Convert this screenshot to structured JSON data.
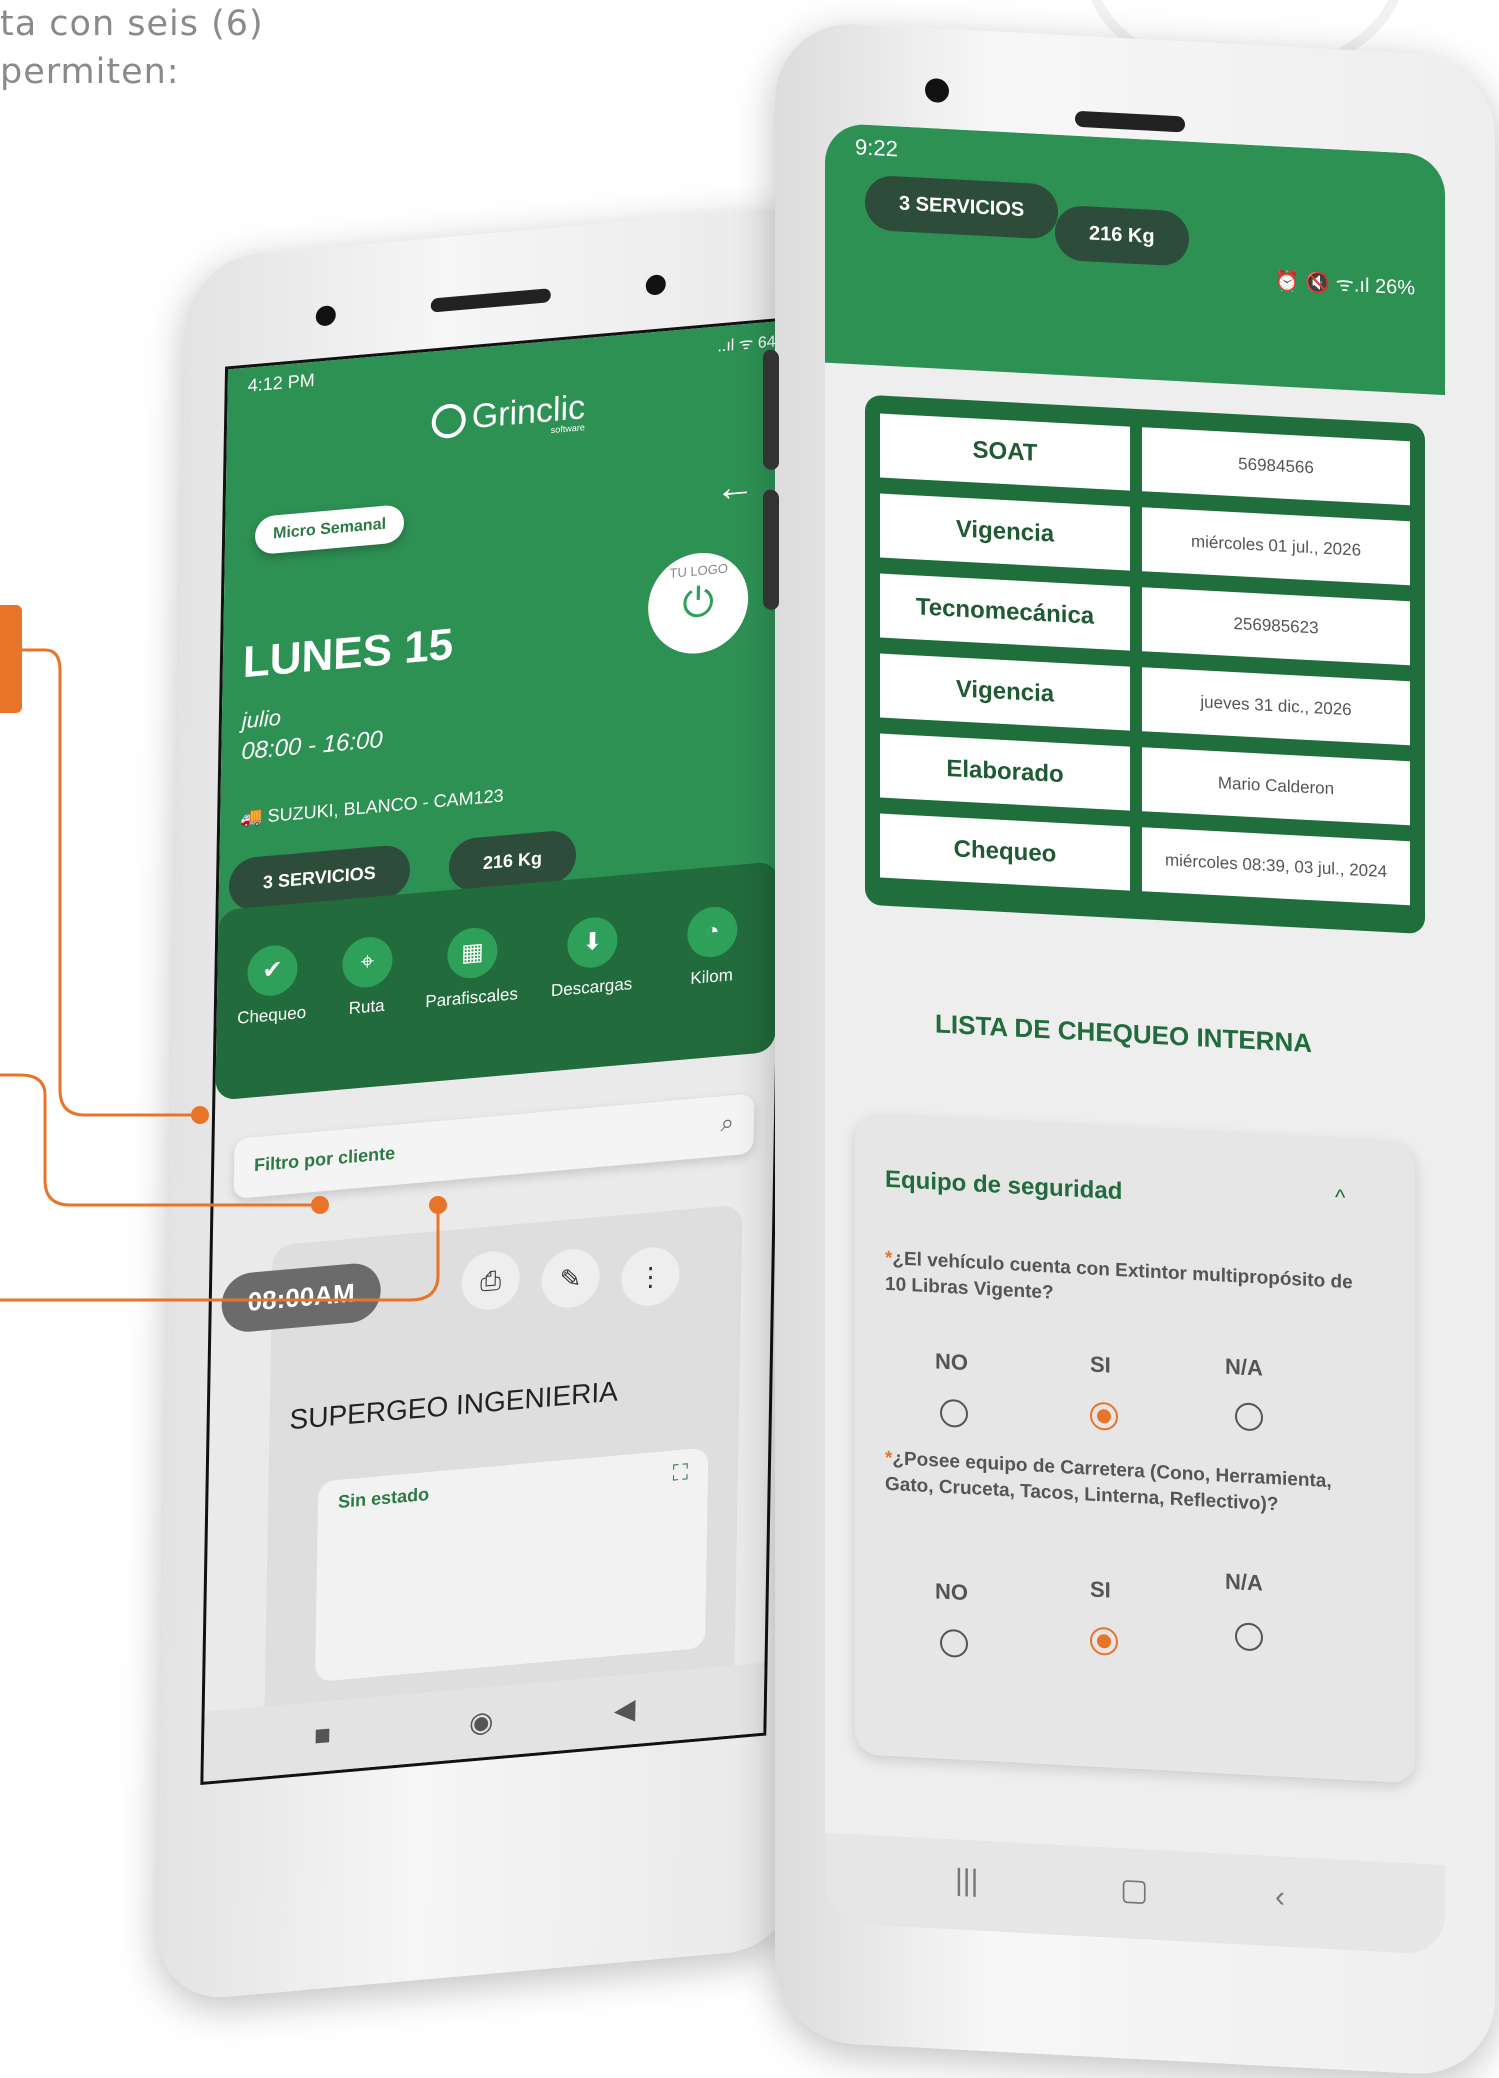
{
  "intro": {
    "line1": "ta con seis (6)",
    "line2": "permiten:"
  },
  "phone_left": {
    "status_time": "4:12 PM",
    "status_icons": "..ıl ᯤ 64",
    "logo_text": "Grinclic",
    "logo_sub": "software",
    "plan_pill": "Micro Semanal",
    "back_arrow": "←",
    "logo_placeholder": "TU LOGO",
    "day_title": "LUNES 15",
    "month": "julio",
    "hours": "08:00 - 16:00",
    "vehicle": "SUZUKI, BLANCO - CAM123",
    "services": "3 SERVICIOS",
    "weight": "216 Kg",
    "menu": [
      {
        "label": "Chequeo",
        "icon": "check-circle-icon",
        "glyph": "✔"
      },
      {
        "label": "Ruta",
        "icon": "map-pin-icon",
        "glyph": "⌖"
      },
      {
        "label": "Parafiscales",
        "icon": "grid-icon",
        "glyph": "▦"
      },
      {
        "label": "Descargas",
        "icon": "download-icon",
        "glyph": "⬇"
      },
      {
        "label": "Kilom",
        "icon": "gauge-icon",
        "glyph": "◔"
      }
    ],
    "filter_label": "Filtro por cliente",
    "search_glyph": "⌕",
    "time_pill": "08:00AM",
    "company": "SUPERGEO INGENIERIA",
    "status_partial": "Sin estado",
    "card_icon_glyph": "⛶",
    "pdf_glyph": "⎙",
    "edit_glyph": "✎",
    "more_glyph": "⋮",
    "nav": {
      "square": "■",
      "home": "◉",
      "back": "◀"
    }
  },
  "phone_right": {
    "status_time": "9:22",
    "status_icons": "⏰ 🔇 ᯤ.ıl 26%",
    "services": "3 SERVICIOS",
    "weight": "216 Kg",
    "table": [
      {
        "key": "SOAT",
        "value": "56984566"
      },
      {
        "key": "Vigencia",
        "value": "miércoles 01 jul., 2026"
      },
      {
        "key": "Tecnomecánica",
        "value": "256985623"
      },
      {
        "key": "Vigencia",
        "value": "jueves 31 dic., 2026"
      },
      {
        "key": "Elaborado",
        "value": "Mario Calderon"
      },
      {
        "key": "Chequeo",
        "value": "miércoles 08:39, 03 jul., 2024"
      }
    ],
    "list_title": "LISTA DE CHEQUEO INTERNA",
    "section_title": "Equipo de seguridad",
    "chevron": "^",
    "questions": [
      {
        "star": "*",
        "text": "¿El vehículo cuenta con Extintor multipropósito  de 10 Libras Vigente?",
        "options": [
          "NO",
          "SI",
          "N/A"
        ],
        "selected": "SI"
      },
      {
        "star": "*",
        "text": "¿Posee equipo de Carretera (Cono, Herramienta, Gato, Cruceta, Tacos, Linterna, Reflectivo)?",
        "options": [
          "NO",
          "SI",
          "N/A"
        ],
        "selected": "SI"
      }
    ],
    "nav": {
      "recent": "|||",
      "home": "▢",
      "back": "‹"
    }
  },
  "colors": {
    "brand_green": "#2e9154",
    "dark_green": "#216b3c",
    "accent_orange": "#e8742a"
  }
}
